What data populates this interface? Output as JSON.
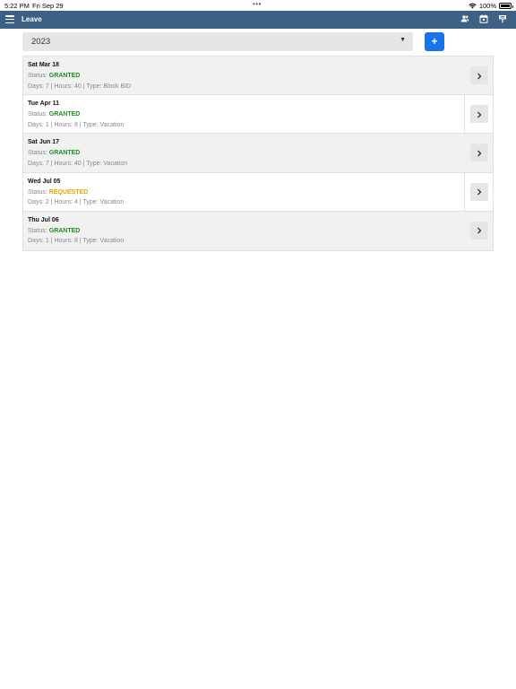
{
  "status_bar": {
    "time": "5:22 PM",
    "date": "Fri Sep 29",
    "dots": "•••",
    "battery": "100%"
  },
  "nav": {
    "title": "Leave",
    "actions": [
      "contacts-icon",
      "calendar-icon",
      "pin-icon"
    ],
    "color": "#3d6085"
  },
  "year_select": {
    "value": "2023",
    "caret": "▼"
  },
  "add_button": {
    "label": "+",
    "color": "#1a73e8"
  },
  "status_colors": {
    "GRANTED": "#1e8e1e",
    "REQUESTED": "#e0a800"
  },
  "leaves": [
    {
      "date": "Sat Mar 18",
      "status_label": "Status:",
      "status": "GRANTED",
      "details": "Days: 7 | Hours: 40 | Type: Block BID"
    },
    {
      "date": "Tue Apr 11",
      "status_label": "Status:",
      "status": "GRANTED",
      "details": "Days: 1 | Hours: 8 | Type: Vacation"
    },
    {
      "date": "Sat Jun 17",
      "status_label": "Status:",
      "status": "GRANTED",
      "details": "Days: 7 | Hours: 40 | Type: Vacation"
    },
    {
      "date": "Wed Jul 05",
      "status_label": "Status:",
      "status": "REQUESTED",
      "details": "Days: 2 | Hours: 4 | Type: Vacation"
    },
    {
      "date": "Thu Jul 06",
      "status_label": "Status:",
      "status": "GRANTED",
      "details": "Days: 1 | Hours: 8 | Type: Vacation"
    }
  ]
}
